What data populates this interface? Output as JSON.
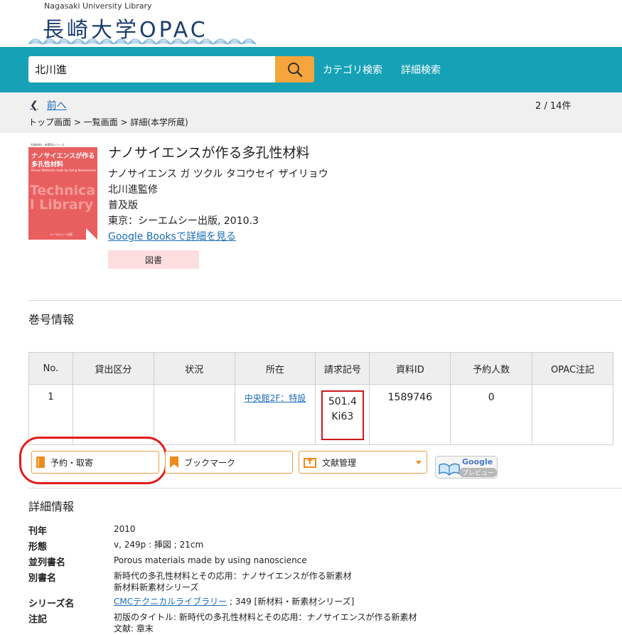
{
  "header": {
    "subtitle": "Nagasaki University Library",
    "logo_text": "長崎大学OPAC"
  },
  "search": {
    "query": "北川進",
    "links": [
      "カテゴリ検索",
      "詳細検索"
    ]
  },
  "nav": {
    "prev_label": "前へ",
    "count": "2 / 14件",
    "breadcrumb": "トップ画面 > 一覧画面 > 詳細(本学所蔵)"
  },
  "book": {
    "cover": {
      "series_label": "先端材料・新素材シリーズ",
      "title_line1": "ナノサイエンスが作る",
      "title_line2": "多孔性材料",
      "subtitle_en": "Porous Materials made by Using Nanoscience",
      "watermark": "Technical Library",
      "publisher": "シーエムシー出版"
    },
    "title": "ナノサイエンスが作る多孔性材料",
    "reading": "ナノサイエンス ガ ツクル タコウセイ ザイリョウ",
    "author": "北川進監修",
    "edition": "普及版",
    "publication": "東京：シーエムシー出版, 2010.3",
    "google_books": "Google Booksで詳細を見る",
    "type_badge": "図書"
  },
  "holdings": {
    "section_title": "巻号情報",
    "headers": [
      "No.",
      "貸出区分",
      "状況",
      "所在",
      "請求記号",
      "資料ID",
      "予約人数",
      "OPAC注記"
    ],
    "rows": [
      {
        "no": "1",
        "loan": "",
        "status": "",
        "location": "中央館2F：特設",
        "call1": "501.4",
        "call2": "Ki63",
        "item_id": "1589746",
        "reservations": "0",
        "note": ""
      }
    ]
  },
  "actions": {
    "reserve": "予約・取寄",
    "bookmark": "ブックマーク",
    "refmgr": "文献管理",
    "google_preview": "Google",
    "google_preview_sub": "プレビュー"
  },
  "details": {
    "section_title": "詳細情報",
    "rows": [
      {
        "label": "刊年",
        "value": "2010"
      },
      {
        "label": "形態",
        "value": "v, 249p : 挿図 ; 21cm"
      },
      {
        "label": "並列書名",
        "value": "Porous materials made by using nanoscience"
      },
      {
        "label": "別書名",
        "value": "新時代の多孔性材料とその応用：ナノサイエンスが作る新素材",
        "value2": "新材料新素材シリーズ"
      },
      {
        "label": "シリーズ名",
        "value_link": "CMCテクニカルライブラリー",
        "value": "; 349 [新材料・新素材シリーズ]"
      },
      {
        "label": "注記",
        "value": "初版のタイトル: 新時代の多孔性材料とその応用：ナノサイエンスが作る新素材",
        "value2": "文献: 章末"
      }
    ]
  },
  "colors": {
    "search_bar": "#17a1b6",
    "search_button": "#f5a53b",
    "link": "#1a6db7",
    "highlight": "#cc1a1a"
  }
}
